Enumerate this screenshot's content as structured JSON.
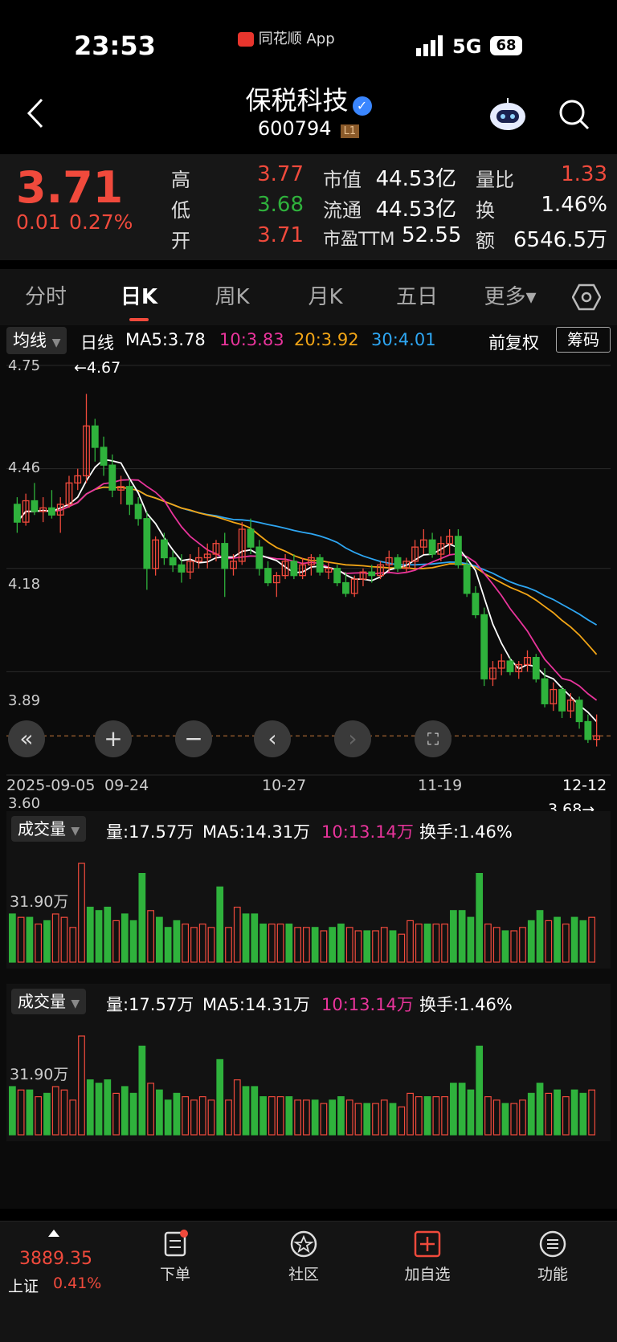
{
  "status": {
    "time": "23:53",
    "app_label": "同花顺 App",
    "network": "5G",
    "battery": "68"
  },
  "header": {
    "title": "保税科技",
    "code": "600794",
    "level_badge": "L1"
  },
  "quote": {
    "price": "3.71",
    "change": "0.01",
    "change_pct": "0.27%",
    "high_label": "高",
    "high": "3.77",
    "low_label": "低",
    "low": "3.68",
    "open_label": "开",
    "open": "3.71",
    "mcap_label": "市值",
    "mcap": "44.53亿",
    "float_label": "流通",
    "float": "44.53亿",
    "pe_label": "市盈TTM",
    "pe": "52.55",
    "vol_ratio_label": "量比",
    "vol_ratio": "1.33",
    "turnover_label": "换",
    "turnover": "1.46%",
    "amount_label": "额",
    "amount": "6546.5万"
  },
  "tabs": [
    {
      "label": "分时"
    },
    {
      "label": "日K"
    },
    {
      "label": "周K"
    },
    {
      "label": "月K"
    },
    {
      "label": "五日"
    },
    {
      "label": "更多▾"
    }
  ],
  "ma_bar": {
    "selector": "均线",
    "period": "日线",
    "ma5": "MA5:3.78",
    "ma10": "10:3.83",
    "ma20": "20:3.92",
    "ma30": "30:4.01",
    "adjust": "前复权",
    "chips": "筹码"
  },
  "chart_labels": {
    "y_ticks": [
      "4.75",
      "4.46",
      "4.18",
      "3.89",
      "3.60"
    ],
    "high_mark": "←4.67",
    "low_mark": "3.68→",
    "x_ticks": [
      "2025-09-05",
      "09-24",
      "10-27",
      "11-19",
      "12-12"
    ]
  },
  "volume_panel": {
    "selector": "成交量",
    "vol": "量:17.57万",
    "ma5": "MA5:14.31万",
    "ma10": "10:13.14万",
    "turnover": "换手:1.46%",
    "y_tick": "31.90万"
  },
  "colors": {
    "up": "#f04a3c",
    "down": "#2fb23c",
    "ma5": "#ffffff",
    "ma10": "#e8349b",
    "ma20": "#f2a516",
    "ma30": "#2ea6f2"
  },
  "bottom": {
    "index_value": "3889.35",
    "index_name": "上证",
    "index_pct": "0.41%",
    "nav": [
      {
        "label": "下单"
      },
      {
        "label": "社区"
      },
      {
        "label": "加自选"
      },
      {
        "label": "功能"
      }
    ]
  },
  "chart_data": {
    "type": "candlestick",
    "ylim": [
      3.6,
      4.75
    ],
    "candles": [
      [
        4.36,
        4.38,
        4.28,
        4.31
      ],
      [
        4.31,
        4.39,
        4.3,
        4.37
      ],
      [
        4.37,
        4.42,
        4.33,
        4.34
      ],
      [
        4.34,
        4.38,
        4.31,
        4.35
      ],
      [
        4.35,
        4.4,
        4.32,
        4.33
      ],
      [
        4.33,
        4.38,
        4.28,
        4.36
      ],
      [
        4.36,
        4.44,
        4.35,
        4.42
      ],
      [
        4.42,
        4.46,
        4.4,
        4.44
      ],
      [
        4.44,
        4.67,
        4.42,
        4.58
      ],
      [
        4.58,
        4.6,
        4.48,
        4.52
      ],
      [
        4.52,
        4.55,
        4.44,
        4.47
      ],
      [
        4.47,
        4.5,
        4.38,
        4.4
      ],
      [
        4.4,
        4.44,
        4.36,
        4.41
      ],
      [
        4.41,
        4.43,
        4.33,
        4.36
      ],
      [
        4.36,
        4.38,
        4.3,
        4.32
      ],
      [
        4.32,
        4.34,
        4.12,
        4.18
      ],
      [
        4.18,
        4.27,
        4.16,
        4.26
      ],
      [
        4.26,
        4.28,
        4.19,
        4.21
      ],
      [
        4.21,
        4.23,
        4.17,
        4.19
      ],
      [
        4.19,
        4.22,
        4.14,
        4.17
      ],
      [
        4.17,
        4.22,
        4.15,
        4.2
      ],
      [
        4.2,
        4.24,
        4.18,
        4.21
      ],
      [
        4.21,
        4.25,
        4.18,
        4.22
      ],
      [
        4.22,
        4.26,
        4.2,
        4.25
      ],
      [
        4.25,
        4.28,
        4.1,
        4.18
      ],
      [
        4.18,
        4.22,
        4.16,
        4.2
      ],
      [
        4.2,
        4.31,
        4.19,
        4.29
      ],
      [
        4.29,
        4.32,
        4.22,
        4.24
      ],
      [
        4.24,
        4.26,
        4.16,
        4.18
      ],
      [
        4.18,
        4.2,
        4.13,
        4.14
      ],
      [
        4.14,
        4.17,
        4.1,
        4.16
      ],
      [
        4.16,
        4.22,
        4.15,
        4.2
      ],
      [
        4.2,
        4.22,
        4.15,
        4.16
      ],
      [
        4.16,
        4.21,
        4.15,
        4.19
      ],
      [
        4.19,
        4.22,
        4.16,
        4.21
      ],
      [
        4.21,
        4.22,
        4.16,
        4.17
      ],
      [
        4.17,
        4.2,
        4.15,
        4.18
      ],
      [
        4.18,
        4.19,
        4.13,
        4.14
      ],
      [
        4.14,
        4.17,
        4.1,
        4.11
      ],
      [
        4.11,
        4.16,
        4.1,
        4.15
      ],
      [
        4.15,
        4.18,
        4.13,
        4.17
      ],
      [
        4.17,
        4.19,
        4.14,
        4.16
      ],
      [
        4.16,
        4.2,
        4.15,
        4.19
      ],
      [
        4.19,
        4.23,
        4.17,
        4.21
      ],
      [
        4.21,
        4.22,
        4.17,
        4.18
      ],
      [
        4.18,
        4.21,
        4.17,
        4.2
      ],
      [
        4.2,
        4.26,
        4.18,
        4.24
      ],
      [
        4.24,
        4.29,
        4.22,
        4.26
      ],
      [
        4.26,
        4.28,
        4.21,
        4.22
      ],
      [
        4.22,
        4.27,
        4.2,
        4.25
      ],
      [
        4.25,
        4.29,
        4.22,
        4.27
      ],
      [
        4.27,
        4.29,
        4.18,
        4.19
      ],
      [
        4.19,
        4.21,
        4.1,
        4.11
      ],
      [
        4.11,
        4.13,
        4.04,
        4.05
      ],
      [
        4.05,
        4.07,
        3.85,
        3.87
      ],
      [
        3.87,
        3.92,
        3.85,
        3.9
      ],
      [
        3.9,
        3.94,
        3.88,
        3.92
      ],
      [
        3.92,
        3.93,
        3.88,
        3.89
      ],
      [
        3.89,
        3.92,
        3.87,
        3.91
      ],
      [
        3.91,
        3.95,
        3.89,
        3.93
      ],
      [
        3.93,
        3.94,
        3.86,
        3.87
      ],
      [
        3.87,
        3.9,
        3.79,
        3.8
      ],
      [
        3.8,
        3.86,
        3.78,
        3.84
      ],
      [
        3.84,
        3.85,
        3.76,
        3.78
      ],
      [
        3.78,
        3.83,
        3.76,
        3.81
      ],
      [
        3.81,
        3.82,
        3.73,
        3.75
      ],
      [
        3.75,
        3.77,
        3.69,
        3.7
      ],
      [
        3.7,
        3.77,
        3.68,
        3.71
      ]
    ],
    "ma5_last": 3.78,
    "ma10_last": 3.83,
    "ma20_last": 3.92,
    "ma30_last": 4.01
  }
}
